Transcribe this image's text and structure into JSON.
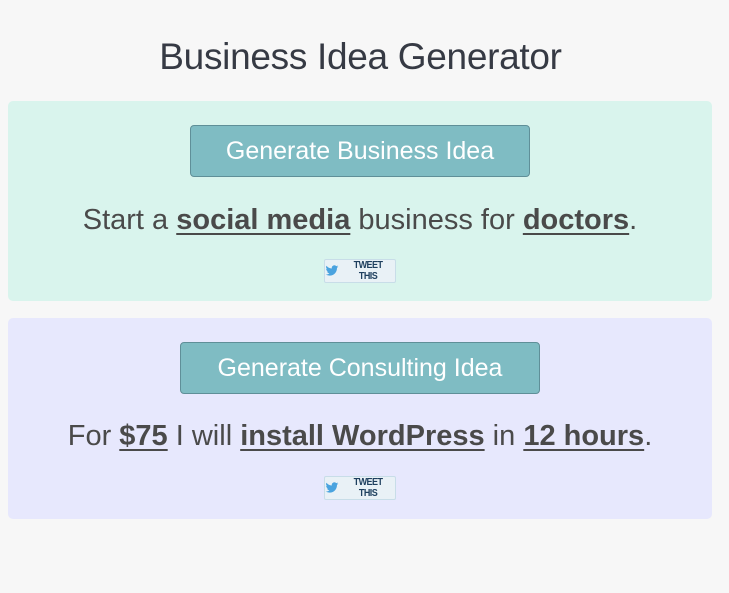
{
  "page": {
    "title": "Business Idea Generator"
  },
  "business": {
    "button_label": "Generate Business Idea",
    "prefix": "Start a ",
    "industry": "social media",
    "middle": " business for ",
    "audience": "doctors",
    "suffix": ".",
    "tweet_label": "TWEET THIS"
  },
  "consulting": {
    "button_label": "Generate Consulting Idea",
    "prefix": "For ",
    "price": "$75",
    "middle1": " I will ",
    "task": "install WordPress",
    "middle2": " in ",
    "duration": "12 hours",
    "suffix": ".",
    "tweet_label": "TWEET THIS"
  },
  "colors": {
    "background": "#f7f7f7",
    "business_panel": "#d9f4ed",
    "consulting_panel": "#e7e8fd",
    "button": "#7fbcc3",
    "twitter_bird": "#4aa3df"
  },
  "icons": {
    "tweet": "twitter-bird-icon"
  }
}
